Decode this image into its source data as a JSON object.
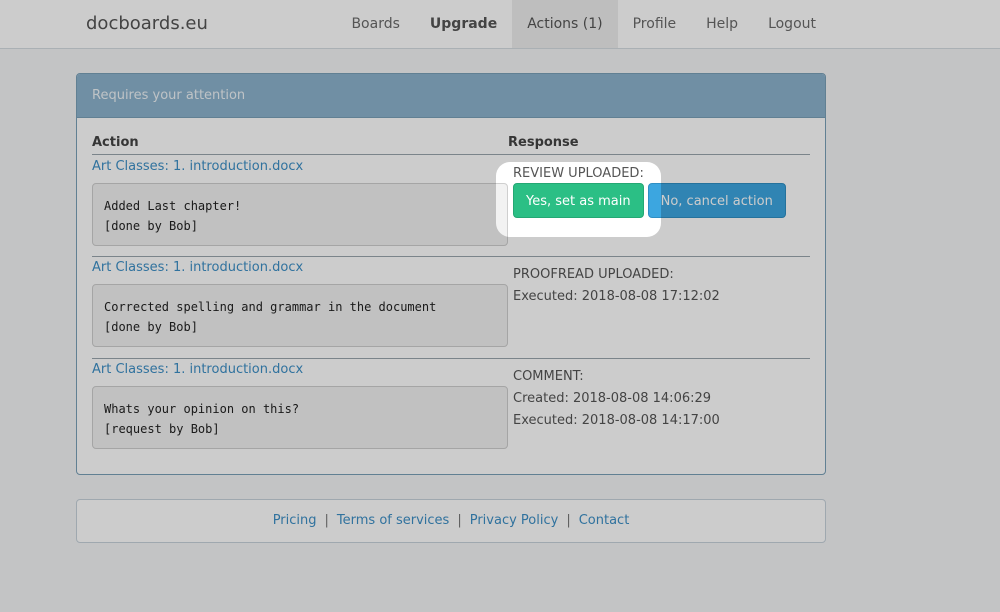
{
  "navbar": {
    "brand": "docboards.eu",
    "items": [
      {
        "label": "Boards"
      },
      {
        "label": "Upgrade"
      },
      {
        "label": "Actions (1)"
      },
      {
        "label": "Profile"
      },
      {
        "label": "Help"
      },
      {
        "label": "Logout"
      }
    ]
  },
  "panel": {
    "title": "Requires your attention",
    "columns": {
      "action": "Action",
      "response": "Response"
    },
    "rows": [
      {
        "doc": "Art Classes: 1. introduction.docx",
        "message_line1": "Added Last chapter!",
        "message_line2": "[done by Bob]",
        "response_type": "REVIEW UPLOADED:",
        "buttons": {
          "confirm": "Yes, set as main",
          "cancel": "No, cancel action"
        }
      },
      {
        "doc": "Art Classes: 1. introduction.docx",
        "message_line1": "Corrected spelling and grammar in the document",
        "message_line2": "[done by Bob]",
        "response_type": "PROOFREAD UPLOADED:",
        "executed": "Executed: 2018-08-08 17:12:02"
      },
      {
        "doc": "Art Classes: 1. introduction.docx",
        "message_line1": "Whats your opinion on this?",
        "message_line2": "[request by Bob]",
        "response_type": "COMMENT:",
        "created": "Created: 2018-08-08 14:06:29",
        "executed": "Executed: 2018-08-08 14:17:00"
      }
    ]
  },
  "footer": {
    "links": [
      {
        "label": "Pricing"
      },
      {
        "label": "Terms of services"
      },
      {
        "label": "Privacy Policy"
      },
      {
        "label": "Contact"
      }
    ],
    "separator": "|"
  },
  "colors": {
    "panel_heading": "#8db3cd",
    "link": "#3d8fc6",
    "success": "#2bbf85",
    "primary": "#3ca6e0"
  }
}
